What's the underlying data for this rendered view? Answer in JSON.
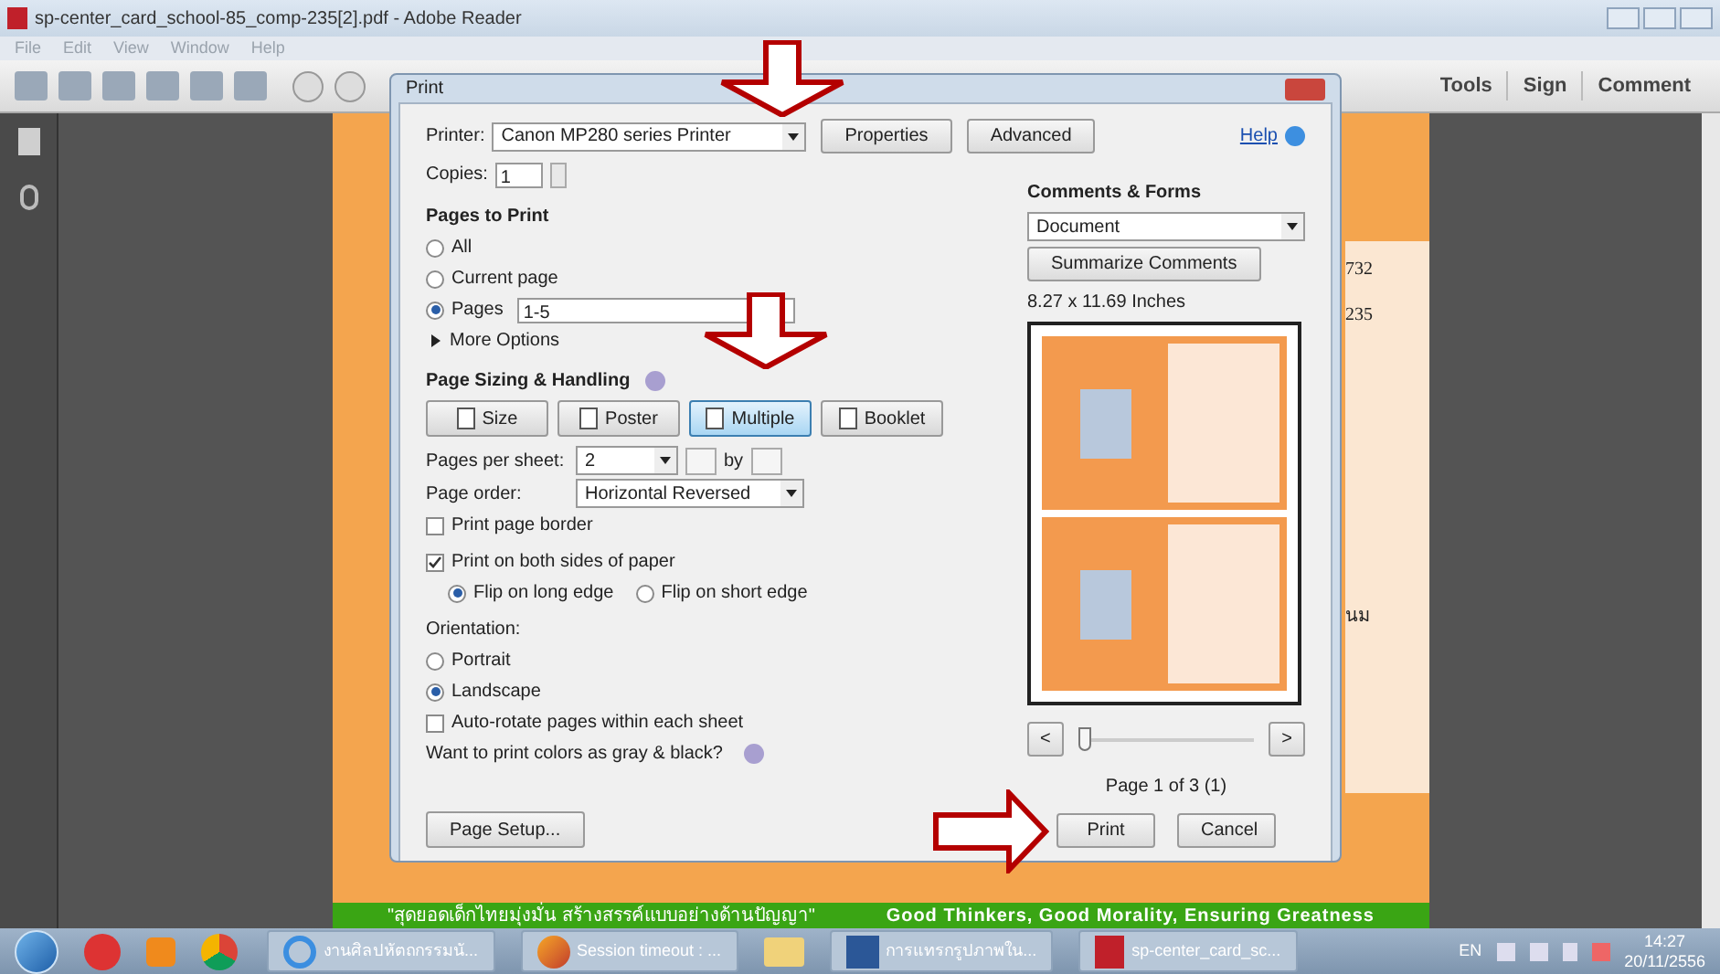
{
  "window": {
    "title": "sp-center_card_school-85_comp-235[2].pdf - Adobe Reader"
  },
  "menu": [
    "File",
    "Edit",
    "View",
    "Window",
    "Help"
  ],
  "toolbar_panes": [
    "Tools",
    "Sign",
    "Comment"
  ],
  "document": {
    "fragments": [
      "732",
      "235",
      "นม"
    ],
    "slogan_thai": "\"สุดยอดเด็กไทยมุ่งมั่น สร้างสรรค์แบบอย่างด้านปัญญา\"",
    "slogan_english": "Good Thinkers, Good Morality, Ensuring Greatness"
  },
  "dialog": {
    "title": "Print",
    "printer_label": "Printer:",
    "printer": "Canon MP280 series Printer",
    "top_buttons": [
      "Properties",
      "Advanced"
    ],
    "help": "Help",
    "copies_label": "Copies:",
    "copies": "1",
    "pages_heading": "Pages to Print",
    "page_options": [
      {
        "label": "All",
        "selected": false
      },
      {
        "label": "Current page",
        "selected": false
      },
      {
        "label": "Pages",
        "selected": true
      }
    ],
    "pages_value": "1-5",
    "more_options": {
      "label": "More Options",
      "expanded": false
    },
    "sizing_heading": "Page Sizing & Handling",
    "sizing_tabs": [
      {
        "label": "Size",
        "selected": false
      },
      {
        "label": "Poster",
        "selected": false
      },
      {
        "label": "Multiple",
        "selected": true
      },
      {
        "label": "Booklet",
        "selected": false
      }
    ],
    "pages_per_sheet_label": "Pages per sheet:",
    "pages_per_sheet": "2",
    "by": "by",
    "page_order_label": "Page order:",
    "page_order": "Horizontal Reversed",
    "print_border": {
      "label": "Print page border",
      "checked": false
    },
    "both_sides": {
      "label": "Print on both sides of paper",
      "checked": true
    },
    "flip_options": [
      {
        "label": "Flip on long edge",
        "selected": true
      },
      {
        "label": "Flip on short edge",
        "selected": false
      }
    ],
    "orientation_label": "Orientation:",
    "orientation_options": [
      {
        "label": "Portrait",
        "selected": false
      },
      {
        "label": "Landscape",
        "selected": true
      }
    ],
    "auto_rotate": {
      "label": "Auto-rotate pages within each sheet",
      "checked": false
    },
    "gray_question": "Want to print colors as gray & black?",
    "comments_heading": "Comments & Forms",
    "comments": "Document",
    "summarize": "Summarize Comments",
    "paper_size": "8.27 x 11.69 Inches",
    "prev": "<",
    "next": ">",
    "preview_slider": {
      "level": 0
    },
    "page_status": "Page 1 of 3 (1)",
    "page_setup": "Page Setup...",
    "print": "Print",
    "cancel": "Cancel"
  },
  "taskbar": {
    "items": [
      {
        "kind": "start"
      },
      {
        "kind": "app"
      },
      {
        "kind": "media"
      },
      {
        "kind": "chrome"
      },
      {
        "kind": "ie",
        "label": "งานศิลปหัตถกรรมนั..."
      },
      {
        "kind": "firefox",
        "label": "Session timeout : ..."
      },
      {
        "kind": "folder"
      },
      {
        "kind": "word",
        "label": "การแทรกรูปภาพใน..."
      },
      {
        "kind": "pdf",
        "label": "sp-center_card_sc..."
      }
    ],
    "language": "EN",
    "time": "14:27",
    "date": "20/11/2556"
  }
}
